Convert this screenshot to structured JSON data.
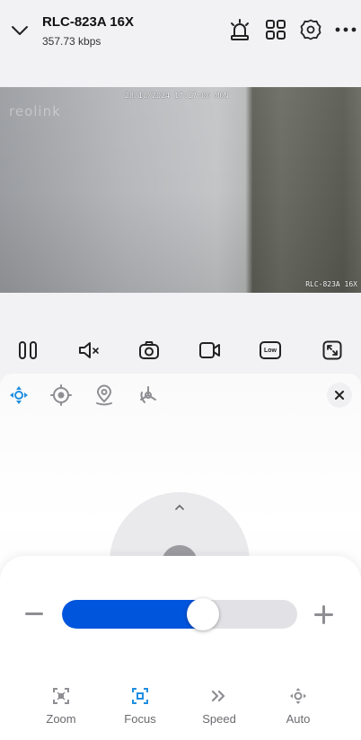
{
  "header": {
    "title": "RLC-823A 16X",
    "bitrate": "357.73 kbps",
    "icons": [
      "chevron-down-icon",
      "siren-icon",
      "grid-icon",
      "gear-icon",
      "more-icon"
    ]
  },
  "video": {
    "timestamp": "28/10/2024 17:17:00 MON",
    "watermark": "reolink",
    "camera_label": "RLC-823A 16X"
  },
  "controls": {
    "buttons": [
      "pause",
      "mute",
      "snapshot",
      "record",
      "quality",
      "fullscreen"
    ],
    "quality_label": "Low"
  },
  "ptz": {
    "tabs": [
      "ptz-move",
      "preset",
      "patrol",
      "track"
    ],
    "active_tab": "ptz-move"
  },
  "focus_sheet": {
    "level": 0.6,
    "modes": [
      {
        "label": "Zoom",
        "icon": "zoom-icon",
        "active": false
      },
      {
        "label": "Focus",
        "icon": "focus-icon",
        "active": true
      },
      {
        "label": "Speed",
        "icon": "speed-icon",
        "active": false
      },
      {
        "label": "Auto",
        "icon": "auto-icon",
        "active": false
      }
    ]
  },
  "colors": {
    "accent": "#0055dd",
    "active_icon": "#1f8fe0",
    "inactive_icon": "#8e8e93"
  }
}
